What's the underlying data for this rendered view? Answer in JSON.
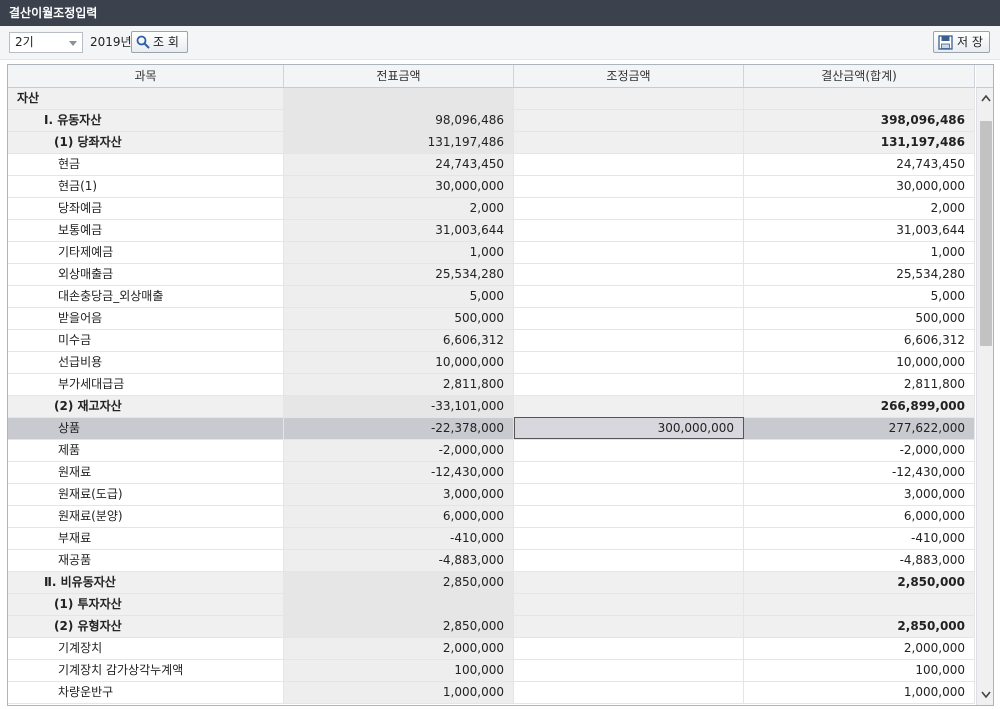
{
  "window": {
    "title": "결산이월조정입력"
  },
  "toolbar": {
    "period": "2기",
    "year": "2019년",
    "search_label": "조 회",
    "save_label": "저 장"
  },
  "table": {
    "headers": [
      "과목",
      "전표금액",
      "조정금액",
      "결산금액(합계)"
    ],
    "rows": [
      {
        "name": "자산",
        "level": 0,
        "group": true,
        "slip": "",
        "adj": "",
        "total": ""
      },
      {
        "name": "Ⅰ. 유동자산",
        "level": 1,
        "group": true,
        "slip": "98,096,486",
        "adj": "",
        "total": "398,096,486"
      },
      {
        "name": "(1) 당좌자산",
        "level": 2,
        "group": true,
        "slip": "131,197,486",
        "adj": "",
        "total": "131,197,486"
      },
      {
        "name": "현금",
        "level": 3,
        "group": false,
        "slip": "24,743,450",
        "adj": "",
        "total": "24,743,450"
      },
      {
        "name": "현금(1)",
        "level": 3,
        "group": false,
        "slip": "30,000,000",
        "adj": "",
        "total": "30,000,000"
      },
      {
        "name": "당좌예금",
        "level": 3,
        "group": false,
        "slip": "2,000",
        "adj": "",
        "total": "2,000"
      },
      {
        "name": "보통예금",
        "level": 3,
        "group": false,
        "slip": "31,003,644",
        "adj": "",
        "total": "31,003,644"
      },
      {
        "name": "기타제예금",
        "level": 3,
        "group": false,
        "slip": "1,000",
        "adj": "",
        "total": "1,000"
      },
      {
        "name": "외상매출금",
        "level": 3,
        "group": false,
        "slip": "25,534,280",
        "adj": "",
        "total": "25,534,280"
      },
      {
        "name": "대손충당금_외상매출",
        "level": 3,
        "group": false,
        "slip": "5,000",
        "adj": "",
        "total": "5,000"
      },
      {
        "name": "받을어음",
        "level": 3,
        "group": false,
        "slip": "500,000",
        "adj": "",
        "total": "500,000"
      },
      {
        "name": "미수금",
        "level": 3,
        "group": false,
        "slip": "6,606,312",
        "adj": "",
        "total": "6,606,312"
      },
      {
        "name": "선급비용",
        "level": 3,
        "group": false,
        "slip": "10,000,000",
        "adj": "",
        "total": "10,000,000"
      },
      {
        "name": "부가세대급금",
        "level": 3,
        "group": false,
        "slip": "2,811,800",
        "adj": "",
        "total": "2,811,800"
      },
      {
        "name": "(2) 재고자산",
        "level": 2,
        "group": true,
        "slip": "-33,101,000",
        "adj": "",
        "total": "266,899,000"
      },
      {
        "name": "상품",
        "level": 3,
        "group": false,
        "selected": true,
        "slip": "-22,378,000",
        "adj": "300,000,000",
        "total": "277,622,000"
      },
      {
        "name": "제품",
        "level": 3,
        "group": false,
        "slip": "-2,000,000",
        "adj": "",
        "total": "-2,000,000"
      },
      {
        "name": "원재료",
        "level": 3,
        "group": false,
        "slip": "-12,430,000",
        "adj": "",
        "total": "-12,430,000"
      },
      {
        "name": "원재료(도급)",
        "level": 3,
        "group": false,
        "slip": "3,000,000",
        "adj": "",
        "total": "3,000,000"
      },
      {
        "name": "원재료(분양)",
        "level": 3,
        "group": false,
        "slip": "6,000,000",
        "adj": "",
        "total": "6,000,000"
      },
      {
        "name": "부재료",
        "level": 3,
        "group": false,
        "slip": "-410,000",
        "adj": "",
        "total": "-410,000"
      },
      {
        "name": "재공품",
        "level": 3,
        "group": false,
        "slip": "-4,883,000",
        "adj": "",
        "total": "-4,883,000"
      },
      {
        "name": "Ⅱ. 비유동자산",
        "level": 1,
        "group": true,
        "slip": "2,850,000",
        "adj": "",
        "total": "2,850,000"
      },
      {
        "name": "(1) 투자자산",
        "level": 2,
        "group": true,
        "slip": "",
        "adj": "",
        "total": ""
      },
      {
        "name": "(2) 유형자산",
        "level": 2,
        "group": true,
        "slip": "2,850,000",
        "adj": "",
        "total": "2,850,000"
      },
      {
        "name": "기계장치",
        "level": 3,
        "group": false,
        "slip": "2,000,000",
        "adj": "",
        "total": "2,000,000"
      },
      {
        "name": "기계장치 감가상각누계액",
        "level": 3,
        "group": false,
        "slip": "100,000",
        "adj": "",
        "total": "100,000"
      },
      {
        "name": "차량운반구",
        "level": 3,
        "group": false,
        "slip": "1,000,000",
        "adj": "",
        "total": "1,000,000"
      }
    ]
  }
}
